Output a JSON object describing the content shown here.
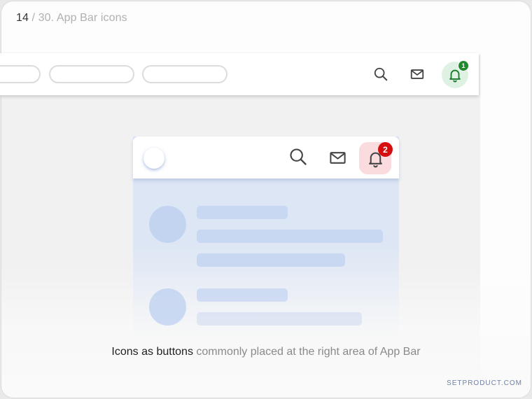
{
  "slide": {
    "current": "14",
    "separator": " / ",
    "title": "30. App Bar icons"
  },
  "top_app_bar": {
    "icons": [
      "search-icon",
      "mail-icon",
      "bell-icon"
    ],
    "notification_badge": "1",
    "badge_color": "#1f8a2e",
    "highlight_color": "#def1e2",
    "bell_color": "#1c7a2c"
  },
  "mobile_app_bar": {
    "icons": [
      "search-icon",
      "mail-icon",
      "bell-icon"
    ],
    "notification_badge": "2",
    "badge_color": "#d50f0f",
    "highlight_color": "#fadcdf"
  },
  "caption": {
    "strong": "Icons as buttons",
    "rest": " commonly placed at the right area of App Bar"
  },
  "brand": "SETPRODUCT.COM"
}
